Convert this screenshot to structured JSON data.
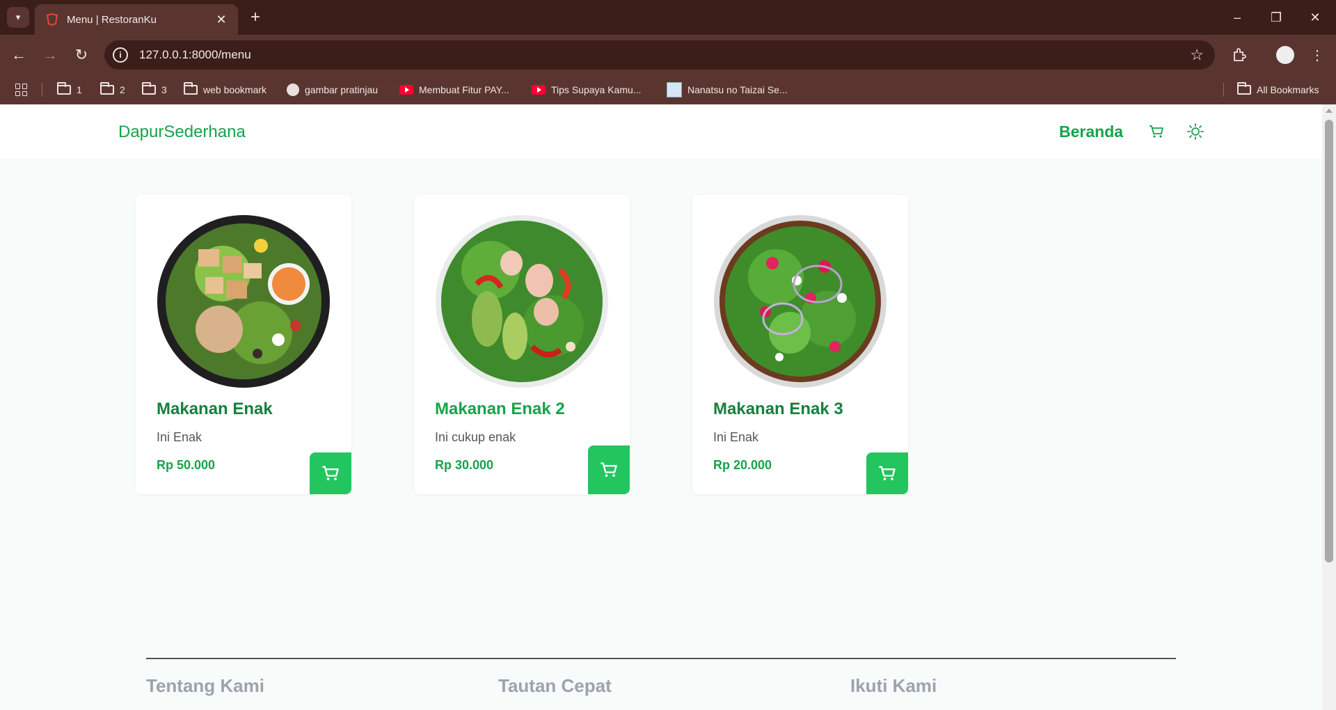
{
  "browser": {
    "tab_title": "Menu | RestoranKu",
    "url": "127.0.0.1:8000/menu",
    "bookmarks": [
      "1",
      "2",
      "3",
      "web bookmark",
      "gambar pratinjau",
      "Membuat Fitur PAY...",
      "Tips Supaya Kamu...",
      "Nanatsu no Taizai Se...",
      "All Bookmarks"
    ]
  },
  "header": {
    "brand": "DapurSederhana",
    "nav_home": "Beranda"
  },
  "menu": {
    "items": [
      {
        "name": "Makanan Enak",
        "desc": "Ini Enak",
        "price": "Rp 50.000"
      },
      {
        "name": "Makanan Enak 2",
        "desc": "Ini cukup enak",
        "price": "Rp 30.000"
      },
      {
        "name": "Makanan Enak 3",
        "desc": "Ini Enak",
        "price": "Rp 20.000"
      }
    ]
  },
  "footer": {
    "headings": [
      "Tentang Kami",
      "Tautan Cepat",
      "Ikuti Kami"
    ]
  },
  "colors": {
    "brand_green": "#16a34a",
    "button_green": "#22c55e",
    "browser_frame": "#3b1e1a",
    "toolbar": "#5a3530"
  },
  "icons": [
    "tab-list-icon",
    "favicon-icon",
    "close-icon",
    "plus-icon",
    "minimize-icon",
    "restore-icon",
    "back-icon",
    "forward-icon",
    "reload-icon",
    "info-icon",
    "star-icon",
    "extensions-icon",
    "profile-icon",
    "more-icon",
    "apps-icon",
    "folder-icon",
    "globe-icon",
    "youtube-icon",
    "cart-icon",
    "sun-icon"
  ]
}
